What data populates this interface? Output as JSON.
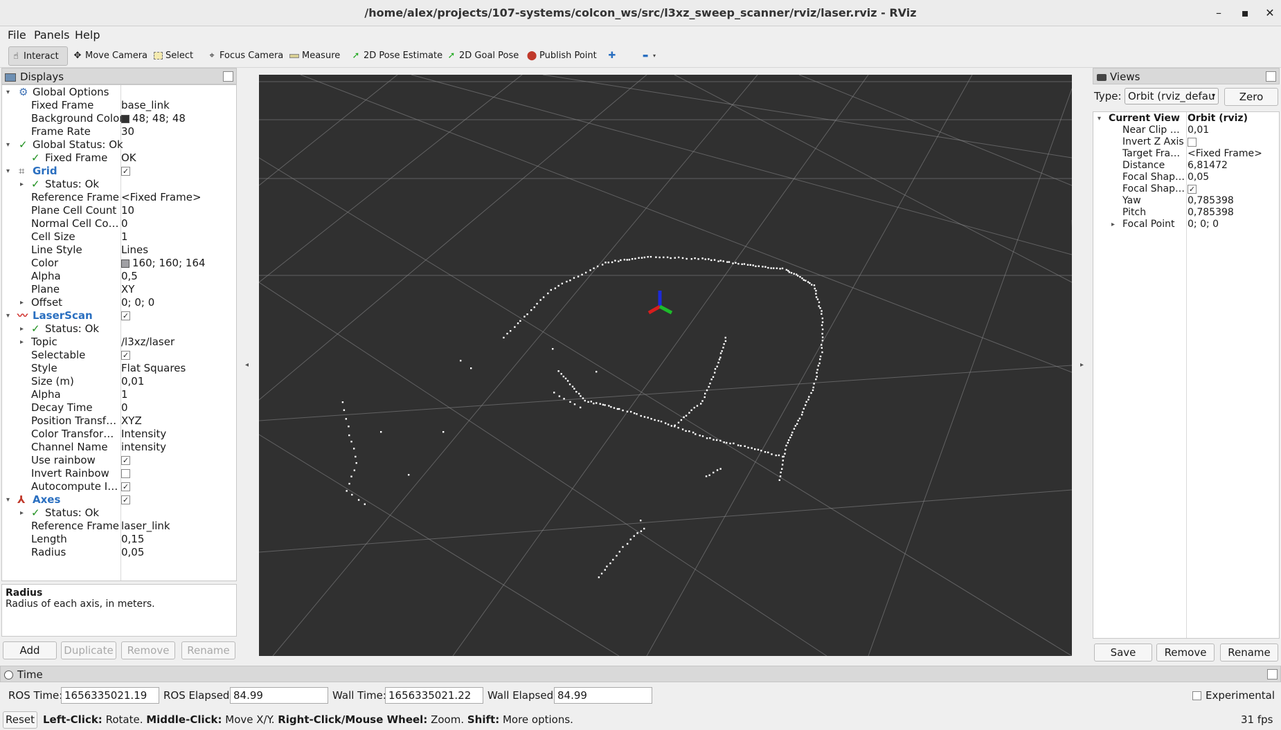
{
  "window": {
    "title": "/home/alex/projects/107-systems/colcon_ws/src/l3xz_sweep_scanner/rviz/laser.rviz - RViz"
  },
  "menu": {
    "file": "File",
    "panels": "Panels",
    "help": "Help"
  },
  "toolbar": {
    "interact": "Interact",
    "move_camera": "Move Camera",
    "select": "Select",
    "focus_camera": "Focus Camera",
    "measure": "Measure",
    "pose_estimate": "2D Pose Estimate",
    "goal_pose": "2D Goal Pose",
    "publish_point": "Publish Point",
    "plus": "✚",
    "minus": "▬"
  },
  "displays": {
    "title": "Displays",
    "global_options": {
      "label": "Global Options",
      "fixed_frame": {
        "name": "Fixed Frame",
        "value": "base_link"
      },
      "background_color": {
        "name": "Background Color",
        "value": "48; 48; 48",
        "color": "#303030"
      },
      "frame_rate": {
        "name": "Frame Rate",
        "value": "30"
      }
    },
    "global_status": {
      "label": "Global Status: Ok",
      "fixed_frame": {
        "name": "Fixed Frame",
        "value": "OK"
      }
    },
    "grid": {
      "label": "Grid",
      "status": "Status: Ok",
      "reference_frame": {
        "name": "Reference Frame",
        "value": "<Fixed Frame>"
      },
      "plane_cell_count": {
        "name": "Plane Cell Count",
        "value": "10"
      },
      "normal_cell_count": {
        "name": "Normal Cell Co…",
        "value": "0"
      },
      "cell_size": {
        "name": "Cell Size",
        "value": "1"
      },
      "line_style": {
        "name": "Line Style",
        "value": "Lines"
      },
      "color": {
        "name": "Color",
        "value": "160; 160; 164",
        "color": "#a0a0a4"
      },
      "alpha": {
        "name": "Alpha",
        "value": "0,5"
      },
      "plane": {
        "name": "Plane",
        "value": "XY"
      },
      "offset": {
        "name": "Offset",
        "value": "0; 0; 0"
      }
    },
    "laserscan": {
      "label": "LaserScan",
      "status": "Status: Ok",
      "topic": {
        "name": "Topic",
        "value": "/l3xz/laser"
      },
      "selectable": {
        "name": "Selectable"
      },
      "style": {
        "name": "Style",
        "value": "Flat Squares"
      },
      "size": {
        "name": "Size (m)",
        "value": "0,01"
      },
      "alpha": {
        "name": "Alpha",
        "value": "1"
      },
      "decay_time": {
        "name": "Decay Time",
        "value": "0"
      },
      "position_transformer": {
        "name": "Position Transf…",
        "value": "XYZ"
      },
      "color_transformer": {
        "name": "Color Transfor…",
        "value": "Intensity"
      },
      "channel_name": {
        "name": "Channel Name",
        "value": "intensity"
      },
      "use_rainbow": {
        "name": "Use rainbow"
      },
      "invert_rainbow": {
        "name": "Invert Rainbow"
      },
      "autocompute": {
        "name": "Autocompute I…"
      }
    },
    "axes": {
      "label": "Axes",
      "status": "Status: Ok",
      "reference_frame": {
        "name": "Reference Frame",
        "value": "laser_link"
      },
      "length": {
        "name": "Length",
        "value": "0,15"
      },
      "radius": {
        "name": "Radius",
        "value": "0,05"
      }
    }
  },
  "description": {
    "title": "Radius",
    "text": "Radius of each axis, in meters."
  },
  "display_buttons": {
    "add": "Add",
    "duplicate": "Duplicate",
    "remove": "Remove",
    "rename": "Rename"
  },
  "views": {
    "title": "Views",
    "type_label": "Type:",
    "type_value": "Orbit (rviz_defau",
    "zero": "Zero",
    "current_view": {
      "name": "Current View",
      "value": "Orbit (rviz)"
    },
    "props": [
      {
        "name": "Near Clip …",
        "value": "0,01"
      },
      {
        "name": "Invert Z Axis",
        "value": ""
      },
      {
        "name": "Target Fra…",
        "value": "<Fixed Frame>"
      },
      {
        "name": "Distance",
        "value": "6,81472"
      },
      {
        "name": "Focal Shap…",
        "value": "0,05"
      },
      {
        "name": "Focal Shap…",
        "value": ""
      },
      {
        "name": "Yaw",
        "value": "0,785398"
      },
      {
        "name": "Pitch",
        "value": "0,785398"
      },
      {
        "name": "Focal Point",
        "value": "0; 0; 0"
      }
    ],
    "save": "Save",
    "remove": "Remove",
    "rename": "Rename"
  },
  "time": {
    "title": "Time",
    "ros_time_label": "ROS Time:",
    "ros_time": "1656335021.19",
    "ros_elapsed_label": "ROS Elapsed:",
    "ros_elapsed": "84.99",
    "wall_time_label": "Wall Time:",
    "wall_time": "1656335021.22",
    "wall_elapsed_label": "Wall Elapsed:",
    "wall_elapsed": "84.99",
    "experimental": "Experimental",
    "reset": "Reset",
    "help_1b": "Left-Click:",
    "help_1": " Rotate. ",
    "help_2b": "Middle-Click:",
    "help_2": " Move X/Y. ",
    "help_3b": "Right-Click/Mouse Wheel:",
    "help_3": " Zoom. ",
    "help_4b": "Shift:",
    "help_4": " More options.",
    "fps": "31 fps"
  },
  "colors": {
    "viewport_bg": "#303030",
    "grid": "#8a8a8c",
    "laser": "#ffffff",
    "accent": "#2a6fc0"
  }
}
